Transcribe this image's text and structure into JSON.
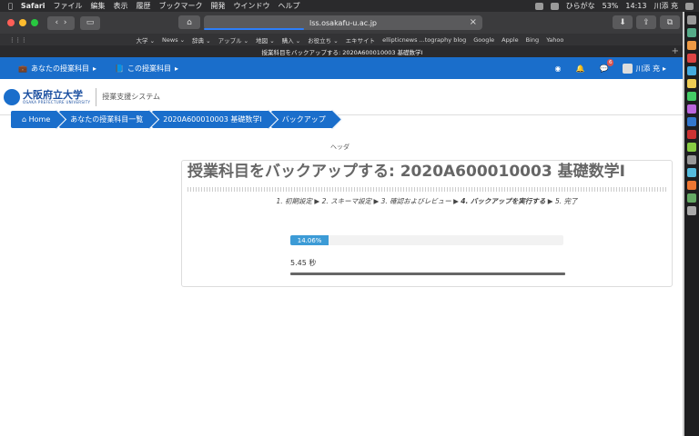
{
  "menubar": {
    "apple": "",
    "items": [
      "Safari",
      "ファイル",
      "編集",
      "表示",
      "履歴",
      "ブックマーク",
      "開発",
      "ウインドウ",
      "ヘルプ"
    ],
    "input_method": "ひらがな",
    "battery": "53%",
    "time": "14:13",
    "user": "川添 充"
  },
  "browser": {
    "url": "lss.osakafu-u.ac.jp",
    "favorites": [
      "大学 ⌄",
      "News ⌄",
      "辞典 ⌄",
      "アップル ⌄",
      "地図 ⌄",
      "購入 ⌄",
      "お役立ち ⌄",
      "エキサイト",
      "ellipticnews ...tography blog",
      "Google",
      "Apple",
      "Bing",
      "Yahoo"
    ],
    "tab_title": "授業科目をバックアップする: 2020A600010003 基礎数学I"
  },
  "navbar": {
    "my_courses": "あなたの授業科目",
    "this_course": "この授業科目",
    "notification_count": "6",
    "user_name": "川添 充"
  },
  "site": {
    "logo_main": "大阪府立大学",
    "logo_sub": "OSAKA PREFECTURE UNIVERSITY",
    "system_name": "授業支援システム"
  },
  "breadcrumb": [
    "Home",
    "あなたの授業科目一覧",
    "2020A600010003 基礎数学I",
    "バックアップ"
  ],
  "header_label": "ヘッダ",
  "page": {
    "title": "授業科目をバックアップする: 2020A600010003 基礎数学I",
    "steps": [
      "1. 初期設定 ▶ 2. スキーマ設定 ▶ 3. 確認およびレビュー ▶ ",
      "4. バックアップを実行する",
      " ▶ 5. 完了"
    ],
    "progress_label": "14.06%",
    "progress": 0.1406,
    "elapsed": "5.45 秒"
  },
  "colors": {
    "brand": "#1a6ecb",
    "progress": "#3c9bd6"
  }
}
